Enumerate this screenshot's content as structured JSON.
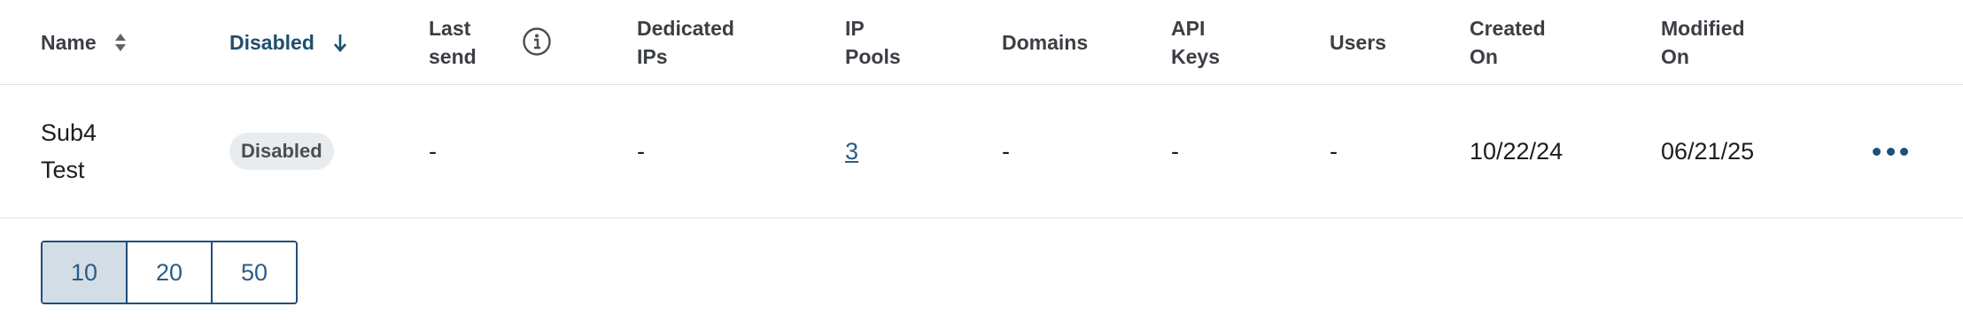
{
  "table": {
    "headers": {
      "name": "Name",
      "disabled": "Disabled",
      "last_send": "Last\nsend",
      "dedicated_ips": "Dedicated\nIPs",
      "ip_pools": "IP\nPools",
      "domains": "Domains",
      "api_keys": "API\nKeys",
      "users": "Users",
      "created_on": "Created\nOn",
      "modified_on": "Modified\nOn"
    },
    "rows": [
      {
        "name": "Sub4\nTest",
        "status_badge": "Disabled",
        "last_send": "-",
        "dedicated_ips": "-",
        "ip_pools": "3",
        "domains": "-",
        "api_keys": "-",
        "users": "-",
        "created_on": "10/22/24",
        "modified_on": "06/21/25"
      }
    ]
  },
  "pagination": {
    "page_sizes": [
      "10",
      "20",
      "50"
    ],
    "selected": "10"
  },
  "colors": {
    "accent": "#1f4e7a",
    "active_header": "#1f4e6e",
    "selected_page_bg": "#d3dde6",
    "badge_bg": "#e9ecef"
  }
}
